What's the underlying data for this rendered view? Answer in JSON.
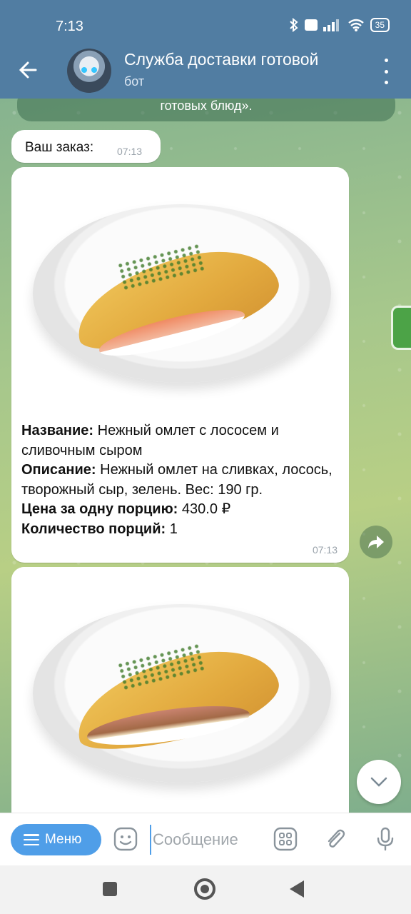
{
  "status_bar": {
    "time": "7:13",
    "battery": "35"
  },
  "header": {
    "title": "Служба доставки готовой",
    "subtitle": "бот"
  },
  "service_message": {
    "text": "готовых блюд»."
  },
  "order_message": {
    "text": "Ваш заказ:",
    "time": "07:13"
  },
  "dishes": [
    {
      "name_label": "Название:",
      "name_value": " Нежный омлет с лососем и сливочным сыром",
      "desc_label": "Описание:",
      "desc_value": " Нежный омлет на сливках, лосось, творожный сыр, зелень. Вес: 190 гр.",
      "price_label": "Цена за одну порцию:",
      "price_value": " 430.0 ₽",
      "qty_label": "Количество порций:",
      "qty_value": " 1",
      "time": "07:13"
    }
  ],
  "input_bar": {
    "menu_label": "Меню",
    "placeholder": "Сообщение"
  },
  "colors": {
    "header": "#517da2",
    "accent": "#4f9ee8",
    "bubble": "#ffffff"
  }
}
